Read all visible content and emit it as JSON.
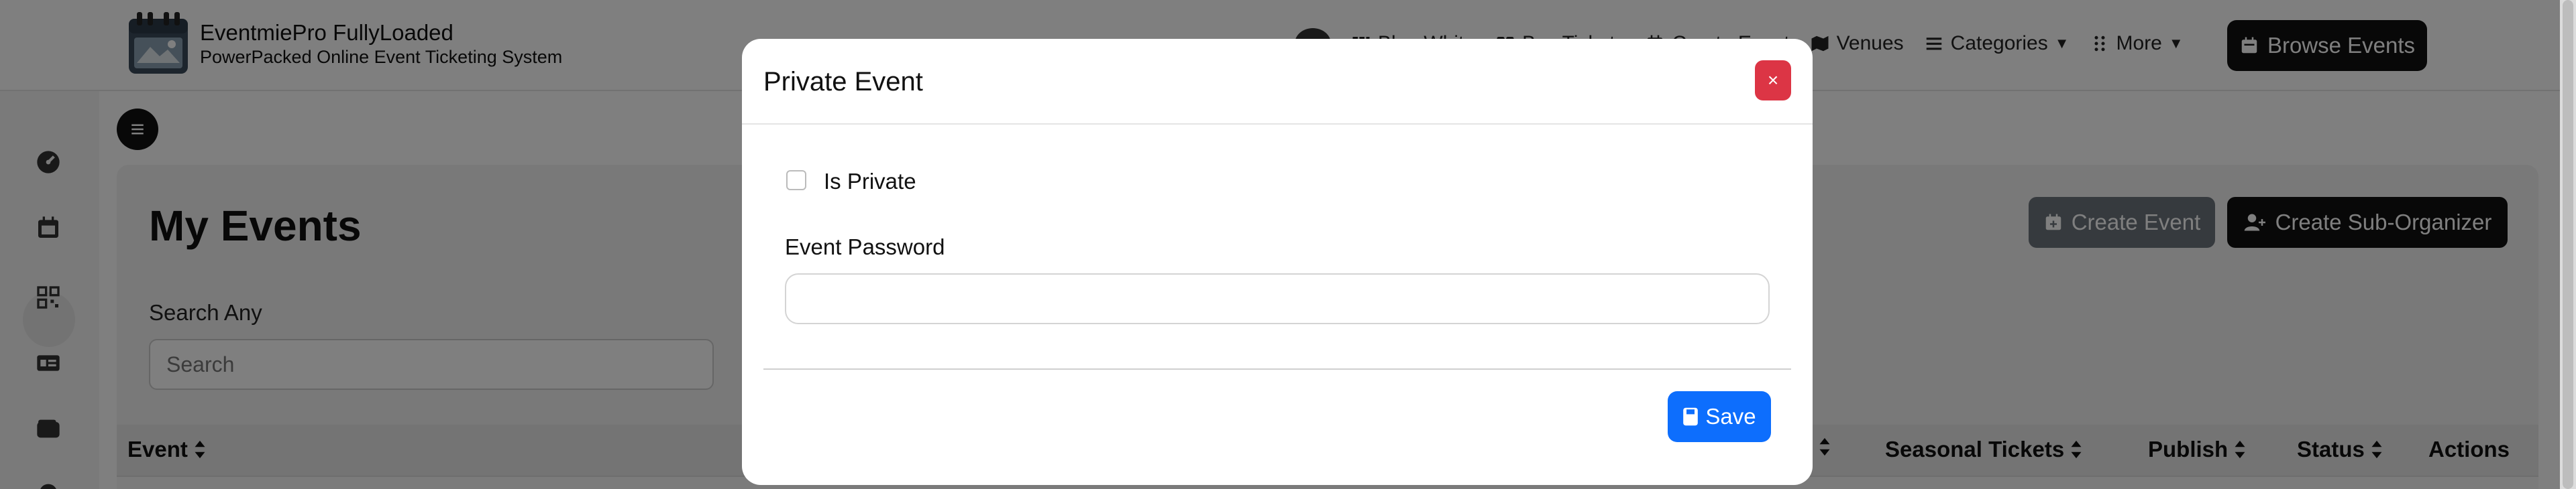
{
  "brand": {
    "title": "EventmiePro FullyLoaded",
    "subtitle": "PowerPacked Online Event Ticketing System"
  },
  "nav": {
    "items": [
      {
        "label": "Blog White",
        "icon": "columns-icon"
      },
      {
        "label": "Buy Tickets",
        "icon": "ticket-icon"
      },
      {
        "label": "Create Event",
        "icon": "calendar-plus-icon"
      },
      {
        "label": "Venues",
        "icon": "map-icon"
      },
      {
        "label": "Categories",
        "icon": "list-icon"
      },
      {
        "label": "More",
        "icon": "grid-dots-icon"
      }
    ],
    "browse_label": "Browse Events"
  },
  "sidebar": {
    "items": [
      "dashboard-icon",
      "calendar-icon",
      "qrcode-icon",
      "id-card-icon",
      "wallet-icon"
    ]
  },
  "main": {
    "title": "My Events",
    "create_event_label": "Create Event",
    "create_sub_organizer_label": "Create Sub-Organizer",
    "search_label": "Search Any",
    "search_placeholder": "Search",
    "columns": {
      "event": "Event",
      "seasonal": "Seasonal Tickets",
      "publish": "Publish",
      "status": "Status",
      "actions": "Actions"
    }
  },
  "modal": {
    "title": "Private Event",
    "close_label": "×",
    "is_private_label": "Is Private",
    "is_private_checked": false,
    "password_label": "Event Password",
    "password_value": "",
    "save_label": "Save"
  },
  "colors": {
    "primary": "#0d6efd",
    "danger": "#dc3545",
    "dark": "#111111",
    "secondary": "#6c757d",
    "backdrop": "rgba(0,0,0,0.5)"
  }
}
